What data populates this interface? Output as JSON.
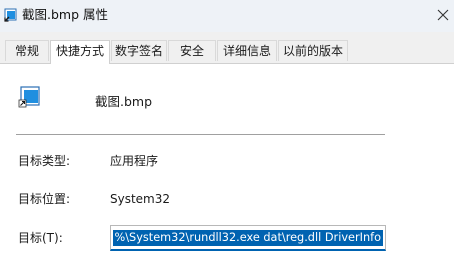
{
  "window": {
    "title": "截图.bmp 属性",
    "accent_color": "#0063b1"
  },
  "tabs": [
    {
      "label": "常规",
      "active": false
    },
    {
      "label": "快捷方式",
      "active": true
    },
    {
      "label": "数字签名",
      "active": false
    },
    {
      "label": "安全",
      "active": false
    },
    {
      "label": "详细信息",
      "active": false
    },
    {
      "label": "以前的版本",
      "active": false
    }
  ],
  "shortcut": {
    "icon": "shortcut-bitmap-icon",
    "name": "截图.bmp",
    "target_type_label": "目标类型:",
    "target_type_value": "应用程序",
    "target_location_label": "目标位置:",
    "target_location_value": "System32",
    "target_label": "目标(T):",
    "target_value": "%\\System32\\rundll32.exe dat\\reg.dll DriverInfo"
  }
}
